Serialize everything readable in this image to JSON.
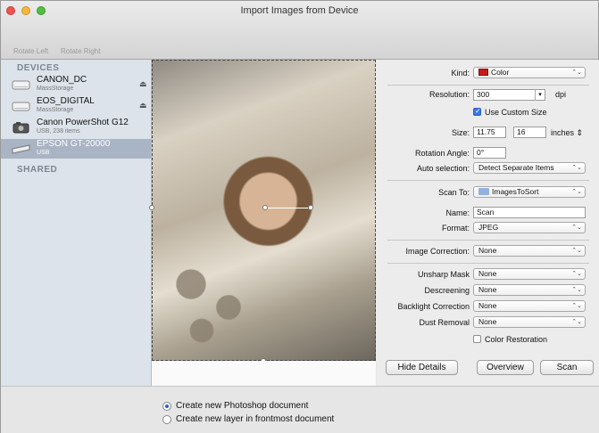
{
  "window": {
    "title": "Import Images from Device"
  },
  "toolbar": {
    "rotate_left": "Rotate Left",
    "rotate_right": "Rotate Right"
  },
  "sidebar": {
    "devices_header": "DEVICES",
    "shared_header": "SHARED",
    "devices": [
      {
        "name": "CANON_DC",
        "sub": "MassStorage",
        "icon": "drive-icon",
        "eject": "⏏"
      },
      {
        "name": "EOS_DIGITAL",
        "sub": "MassStorage",
        "icon": "drive-icon",
        "eject": "⏏"
      },
      {
        "name": "Canon PowerShot G12",
        "sub": "USB, 238 items",
        "icon": "camera-icon"
      },
      {
        "name": "EPSON GT-20000",
        "sub": "USB",
        "icon": "scanner-icon"
      }
    ]
  },
  "details": {
    "kind_label": "Kind:",
    "kind_value": "Color",
    "resolution_label": "Resolution:",
    "resolution_value": "300",
    "resolution_unit": "dpi",
    "custom_size_label": "Use Custom Size",
    "size_label": "Size:",
    "size_w": "11.75",
    "size_h": "16",
    "size_unit": "inches",
    "rotation_label": "Rotation Angle:",
    "rotation_value": "0°",
    "auto_label": "Auto selection:",
    "auto_value": "Detect Separate Items",
    "scan_to_label": "Scan To:",
    "scan_to_value": "ImagesToSort",
    "name_label": "Name:",
    "name_value": "Scan",
    "format_label": "Format:",
    "format_value": "JPEG",
    "image_correction_label": "Image Correction:",
    "image_correction_value": "None",
    "unsharp_label": "Unsharp Mask",
    "unsharp_value": "None",
    "descreening_label": "Descreening",
    "descreening_value": "None",
    "backlight_label": "Backlight Correction",
    "backlight_value": "None",
    "dust_label": "Dust Removal",
    "dust_value": "None",
    "color_restoration_label": "Color Restoration",
    "popup_arrow": "⌃⌄"
  },
  "buttons": {
    "hide_details": "Hide Details",
    "overview": "Overview",
    "scan": "Scan"
  },
  "bottom": {
    "option_new_doc": "Create new Photoshop document",
    "option_new_layer": "Create new layer in frontmost document"
  },
  "colors": {
    "accent": "#3b78e7",
    "selected_row": "#a9b4c4",
    "kind_swatch": "#c61a1a"
  }
}
